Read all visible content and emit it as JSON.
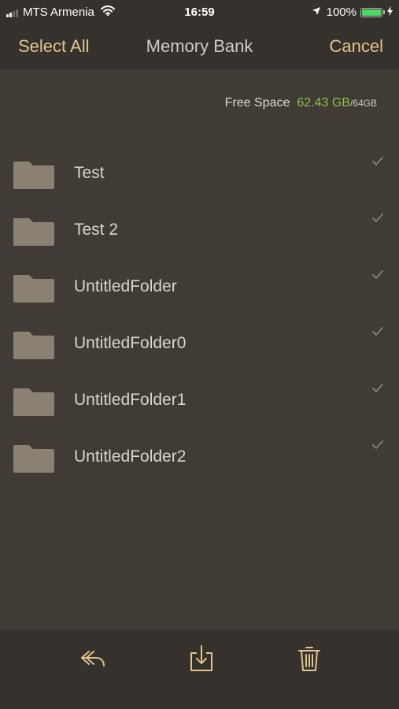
{
  "status_bar": {
    "carrier": "MTS Armenia",
    "time": "16:59",
    "battery_percent": "100%",
    "battery_level": 1.0,
    "signal_bars": 2,
    "icons": [
      "signal-icon",
      "wifi-icon",
      "location-icon",
      "battery-icon",
      "charging-icon"
    ]
  },
  "nav": {
    "left_label": "Select All",
    "title": "Memory Bank",
    "right_label": "Cancel"
  },
  "storage": {
    "label": "Free Space",
    "free": "62.43 GB",
    "total": "/64GB"
  },
  "folders": [
    {
      "name": "Test"
    },
    {
      "name": "Test 2"
    },
    {
      "name": "UntitledFolder"
    },
    {
      "name": "UntitledFolder0"
    },
    {
      "name": "UntitledFolder1"
    },
    {
      "name": "UntitledFolder2"
    }
  ],
  "toolbar": {
    "icons": [
      "reply-icon",
      "import-icon",
      "trash-icon"
    ]
  },
  "colors": {
    "accent": "#e2c48d",
    "background": "#403b35",
    "bar": "#35312c",
    "free_space": "#8bc34a",
    "folder": "#8a8173",
    "battery": "#4cd964"
  }
}
